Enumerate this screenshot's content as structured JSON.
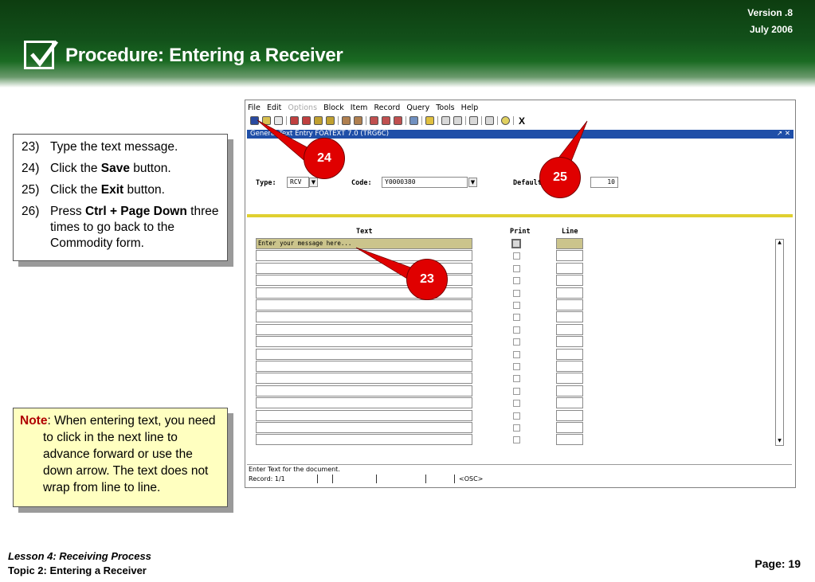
{
  "header": {
    "version": "Version .8",
    "date": "July  2006",
    "title": "Procedure: Entering a Receiver"
  },
  "steps": [
    {
      "num": "23)",
      "pre": "Type the text message.",
      "bold": "",
      "post": ""
    },
    {
      "num": "24)",
      "pre": "Click the ",
      "bold": "Save",
      "post": " button."
    },
    {
      "num": "25)",
      "pre": "Click the ",
      "bold": "Exit",
      "post": " button."
    },
    {
      "num": "26)",
      "pre": "Press ",
      "bold": "Ctrl + Page Down",
      "post": " three times to go back to the Commodity form."
    }
  ],
  "note": {
    "label": "Note",
    "text": ": When entering text, you need to click in the next line to advance forward or use the down arrow.  The text does not wrap from line to line."
  },
  "app": {
    "menu": [
      "File",
      "Edit",
      "Options",
      "Block",
      "Item",
      "Record",
      "Query",
      "Tools",
      "Help"
    ],
    "exit_glyph": "X",
    "window_title": "General Text Entry  FOATEXT  7.0  (TRG6C)",
    "window_controls": "↗ ✕",
    "type_label": "Type:",
    "type_value": "RCV",
    "code_label": "Code:",
    "code_value": "Y0000380",
    "default_label": "Default",
    "default_value": "10",
    "col_text": "Text",
    "col_print": "Print",
    "col_line": "Line",
    "first_row_text": "Enter your message here...",
    "status_message": "Enter Text for the document.",
    "record": "Record: 1/1",
    "mode": "<OSC>"
  },
  "callouts": {
    "c24": "24",
    "c25": "25",
    "c23": "23"
  },
  "footer": {
    "lesson": "Lesson 4: Receiving Process",
    "topic": "Topic 2: Entering a Receiver",
    "page": "Page: 19"
  },
  "colors": {
    "header_green": "#12501a",
    "callout_red": "#e00000",
    "note_yellow": "#ffffc0",
    "titlebar_blue": "#1f4fa8"
  },
  "icons": [
    "check-box-icon",
    "save-icon",
    "exit-icon",
    "lov-arrow-icon",
    "scroll-up-icon",
    "scroll-down-icon"
  ]
}
